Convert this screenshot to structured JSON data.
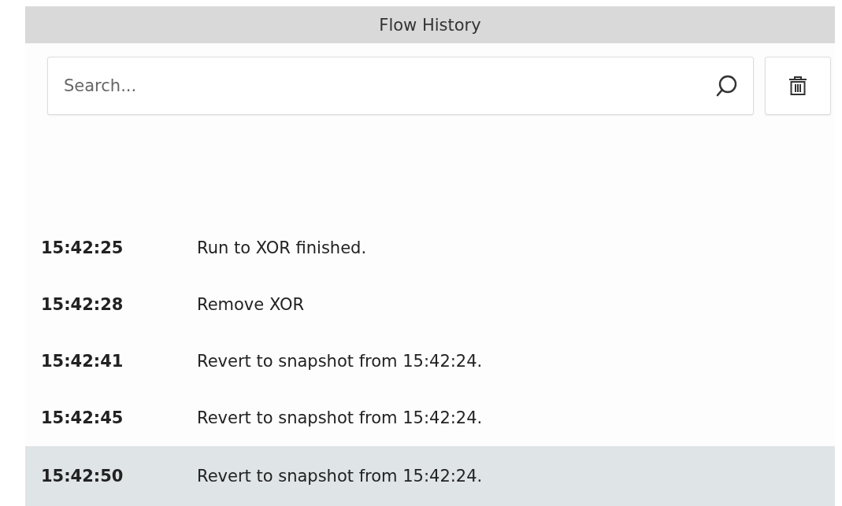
{
  "panel": {
    "title": "Flow History"
  },
  "search": {
    "placeholder": "Search..."
  },
  "entries": [
    {
      "time": "15:42:25",
      "message": "Run to XOR finished.",
      "selected": false
    },
    {
      "time": "15:42:28",
      "message": "Remove XOR",
      "selected": false
    },
    {
      "time": "15:42:41",
      "message": "Revert to snapshot from 15:42:24.",
      "selected": false
    },
    {
      "time": "15:42:45",
      "message": "Revert to snapshot from 15:42:24.",
      "selected": false
    },
    {
      "time": "15:42:50",
      "message": "Revert to snapshot from 15:42:24.",
      "selected": true
    }
  ]
}
